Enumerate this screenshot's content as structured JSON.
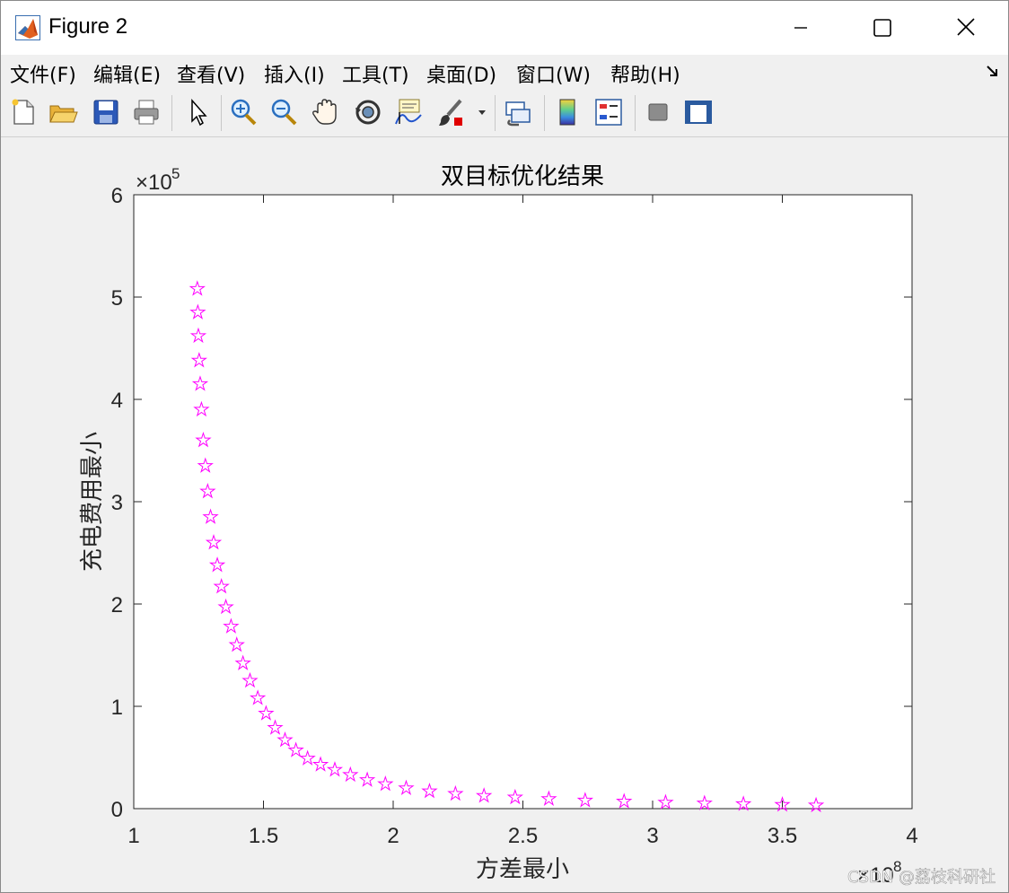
{
  "window": {
    "title": "Figure 2"
  },
  "menu": {
    "items": [
      {
        "label": "文件(F)"
      },
      {
        "label": "编辑(E)"
      },
      {
        "label": "查看(V)"
      },
      {
        "label": "插入(I)"
      },
      {
        "label": "工具(T)"
      },
      {
        "label": "桌面(D)"
      },
      {
        "label": "窗口(W)"
      },
      {
        "label": "帮助(H)"
      }
    ]
  },
  "toolbar": {
    "icons": [
      "new-figure-icon",
      "open-file-icon",
      "save-icon",
      "print-icon",
      "edit-plot-arrow-icon",
      "zoom-in-icon",
      "zoom-out-icon",
      "pan-hand-icon",
      "rotate-3d-icon",
      "data-cursor-icon",
      "brush-icon",
      "brush-dropdown-icon",
      "link-plot-icon",
      "insert-colorbar-icon",
      "insert-legend-icon",
      "hide-plot-tools-icon",
      "show-plot-tools-icon"
    ]
  },
  "chart_data": {
    "type": "scatter",
    "title": "双目标优化结果",
    "xlabel": "方差最小",
    "ylabel": "充电费用最小",
    "xlim": [
      1,
      4
    ],
    "ylim": [
      0,
      6
    ],
    "x_exponent": "×10",
    "x_exponent_power": "8",
    "y_exponent": "×10",
    "y_exponent_power": "5",
    "x_ticks": [
      "1",
      "1.5",
      "2",
      "2.5",
      "3",
      "3.5",
      "4"
    ],
    "y_ticks": [
      "0",
      "1",
      "2",
      "3",
      "4",
      "5",
      "6"
    ],
    "marker": "pentagram",
    "marker_color": "#ff00ff",
    "grid": false,
    "series": [
      {
        "x": [
          1.245,
          1.247,
          1.249,
          1.252,
          1.256,
          1.261,
          1.268,
          1.276,
          1.285,
          1.296,
          1.308,
          1.322,
          1.338,
          1.355,
          1.375,
          1.397,
          1.421,
          1.448,
          1.478,
          1.51,
          1.545,
          1.583,
          1.625,
          1.67,
          1.72,
          1.775,
          1.835,
          1.9,
          1.97,
          2.05,
          2.14,
          2.24,
          2.35,
          2.47,
          2.6,
          2.74,
          2.89,
          3.05,
          3.2,
          3.35,
          3.5,
          3.63
        ],
        "y": [
          5.08,
          4.85,
          4.62,
          4.38,
          4.15,
          3.9,
          3.6,
          3.35,
          3.1,
          2.85,
          2.6,
          2.38,
          2.17,
          1.97,
          1.78,
          1.6,
          1.42,
          1.25,
          1.08,
          0.93,
          0.79,
          0.67,
          0.57,
          0.49,
          0.43,
          0.38,
          0.33,
          0.28,
          0.24,
          0.2,
          0.17,
          0.145,
          0.125,
          0.11,
          0.095,
          0.08,
          0.07,
          0.06,
          0.052,
          0.045,
          0.038,
          0.032
        ]
      }
    ]
  },
  "watermark": "CSDN @荔枝科研社"
}
